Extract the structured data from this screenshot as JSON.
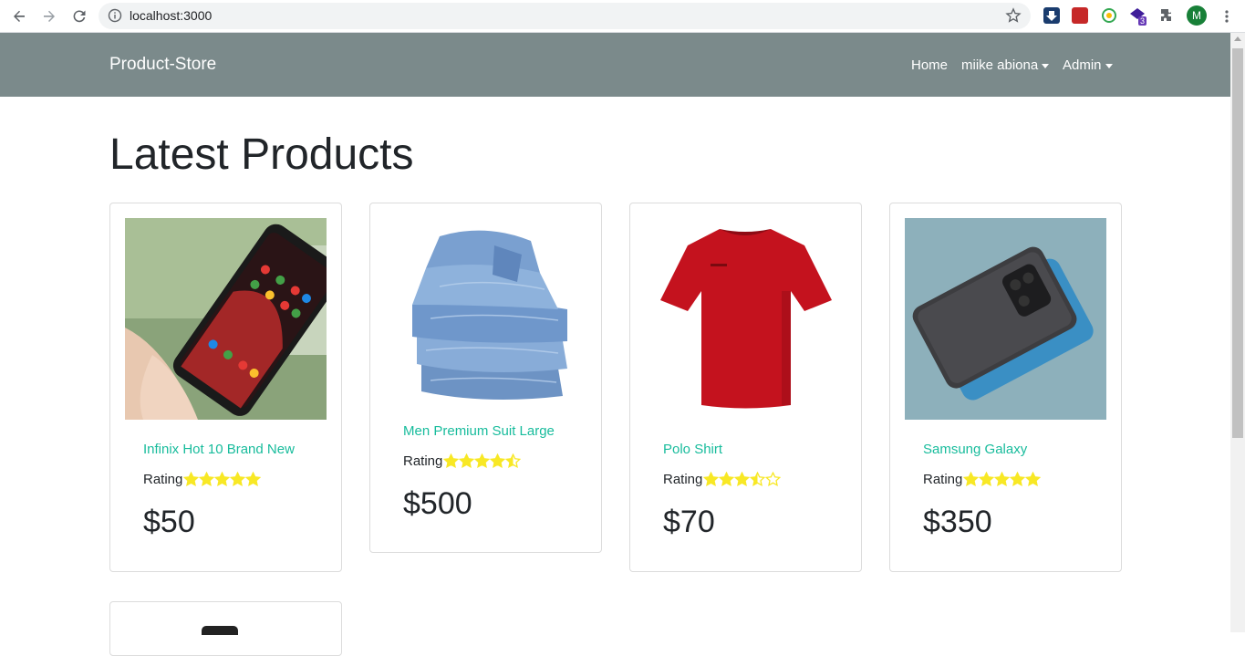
{
  "browser": {
    "url": "localhost:3000",
    "profile_initial": "M",
    "extension_badge": "3"
  },
  "navbar": {
    "brand": "Product-Store",
    "links": [
      {
        "label": "Home"
      },
      {
        "label": "miike abiona"
      },
      {
        "label": "Admin"
      }
    ]
  },
  "page": {
    "title": "Latest Products"
  },
  "products": [
    {
      "name": "Infinix Hot 10 Brand New",
      "rating_label": "Rating",
      "rating": 5,
      "price": "$50"
    },
    {
      "name": "Men Premium Suit Large",
      "rating_label": "Rating",
      "rating": 4.5,
      "price": "$500"
    },
    {
      "name": "Polo Shirt",
      "rating_label": "Rating",
      "rating": 3.5,
      "price": "$70"
    },
    {
      "name": "Samsung Galaxy",
      "rating_label": "Rating",
      "rating": 5,
      "price": "$350"
    }
  ],
  "colors": {
    "navbar": "#7b8a8b",
    "link": "#18bc9c",
    "star": "#f8e825"
  },
  "icons": [
    "back-icon",
    "forward-icon",
    "reload-icon",
    "info-icon",
    "bookmark-star-icon",
    "puzzle-icon",
    "menu-icon"
  ]
}
